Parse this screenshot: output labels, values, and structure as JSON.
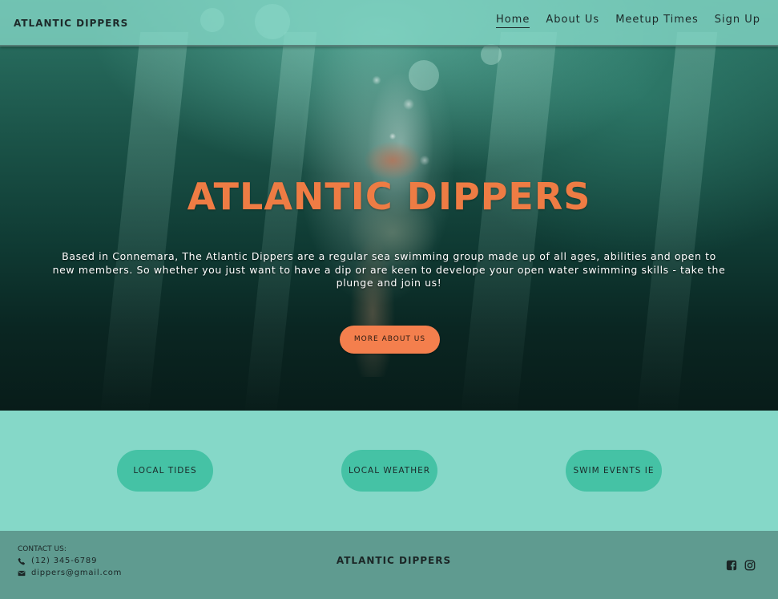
{
  "nav": {
    "brand": "ATLANTIC DIPPERS",
    "links": [
      {
        "label": "Home",
        "active": true
      },
      {
        "label": "About Us",
        "active": false
      },
      {
        "label": "Meetup Times",
        "active": false
      },
      {
        "label": "Sign Up",
        "active": false
      }
    ]
  },
  "hero": {
    "title": "ATLANTIC DIPPERS",
    "text": "Based in Connemara, The Atlantic Dippers are a regular sea swimming group made up of all ages, abilities and open to new members. So whether you just want to have a dip or are keen to develope your open water swimming skills - take the plunge and join us!",
    "button": "MORE ABOUT US"
  },
  "links": [
    {
      "label": "LOCAL TIDES"
    },
    {
      "label": "LOCAL WEATHER"
    },
    {
      "label": "SWIM EVENTS IE"
    }
  ],
  "footer": {
    "contact_title": "CONTACT US:",
    "phone": "(12) 345-6789",
    "email": "dippers@gmail.com",
    "brand": "ATLANTIC DIPPERS",
    "icons": [
      "facebook-icon",
      "instagram-icon"
    ]
  },
  "colors": {
    "accent": "#f47f4d",
    "title": "#ee7c44",
    "teal": "#85d8c8",
    "pill": "#45c2a5",
    "footer": "#5f9b90"
  }
}
